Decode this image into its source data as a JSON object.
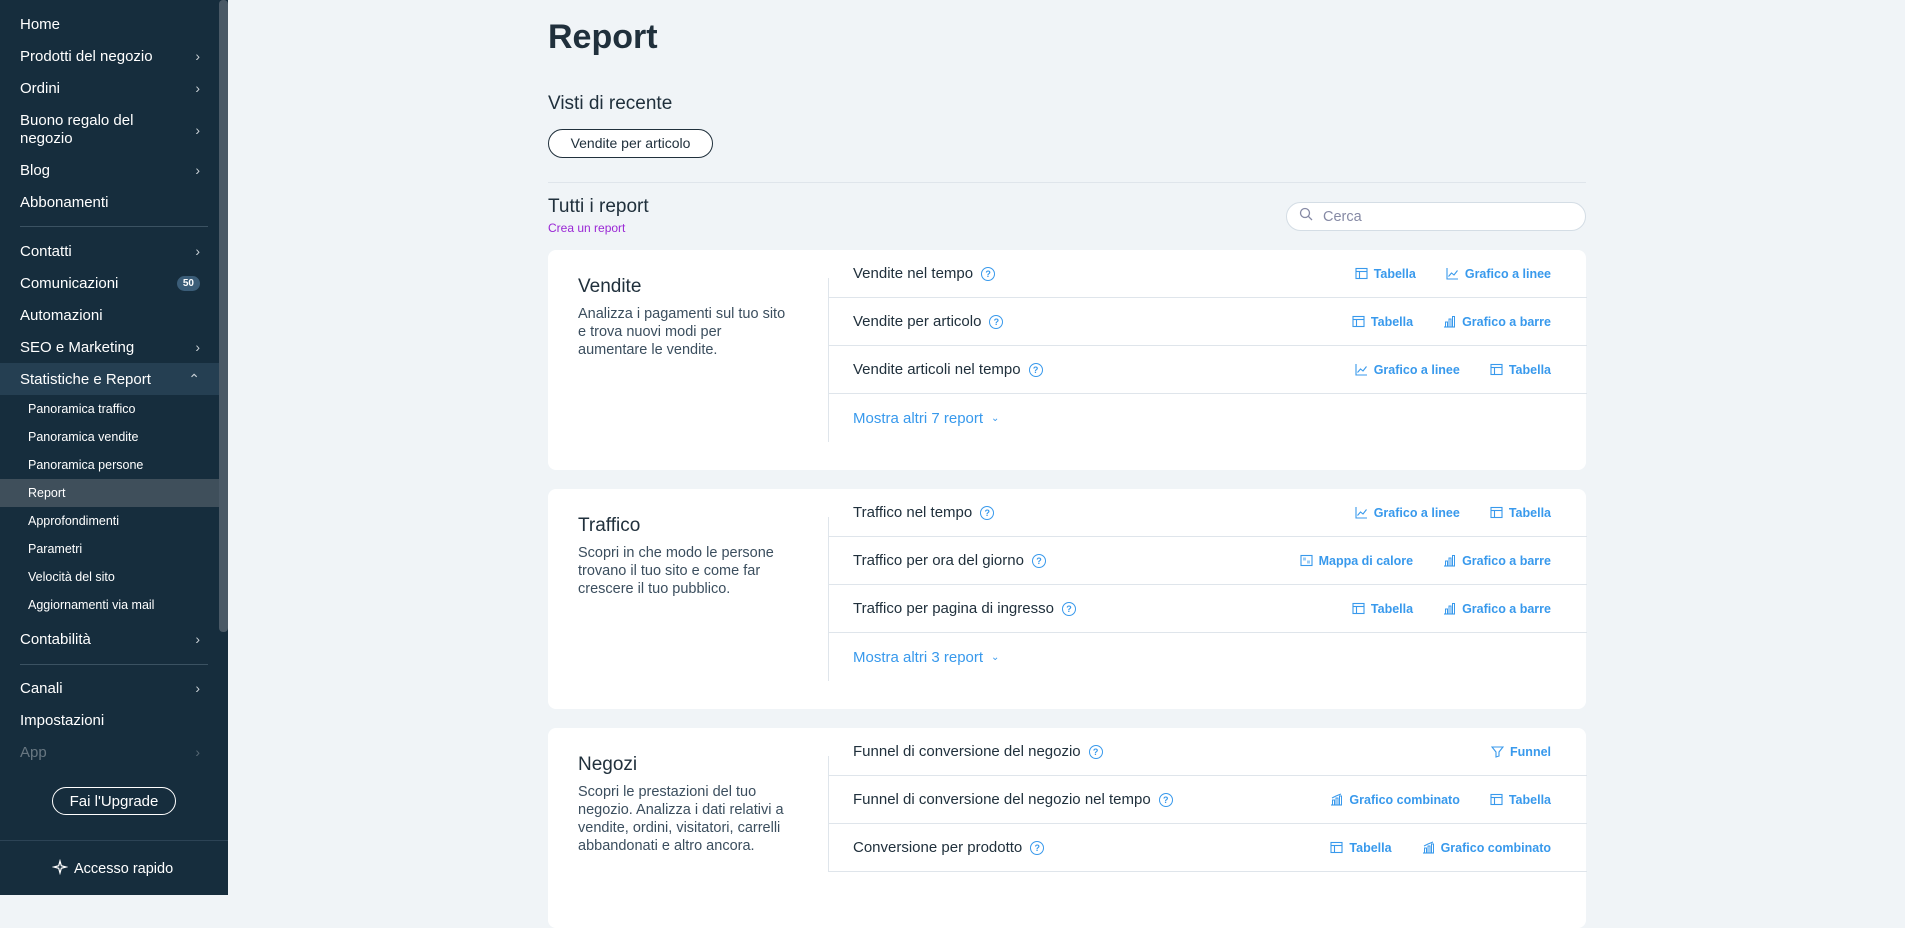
{
  "sidebar": {
    "items": [
      {
        "label": "Home",
        "chevron": false
      },
      {
        "label": "Prodotti del negozio",
        "chevron": true
      },
      {
        "label": "Ordini",
        "chevron": true
      },
      {
        "label": "Buono regalo del negozio",
        "chevron": true
      },
      {
        "label": "Blog",
        "chevron": true
      },
      {
        "label": "Abbonamenti",
        "chevron": false
      },
      {
        "label": "Contatti",
        "chevron": true
      },
      {
        "label": "Comunicazioni",
        "chevron": false,
        "badge": "50"
      },
      {
        "label": "Automazioni",
        "chevron": false
      },
      {
        "label": "SEO e Marketing",
        "chevron": true
      },
      {
        "label": "Statistiche e Report",
        "chevron": true,
        "expanded": true
      },
      {
        "label": "Contabilità",
        "chevron": true
      },
      {
        "label": "Canali",
        "chevron": true
      },
      {
        "label": "Impostazioni",
        "chevron": false
      },
      {
        "label": "App",
        "chevron": true
      }
    ],
    "subitems": [
      {
        "label": "Panoramica traffico"
      },
      {
        "label": "Panoramica vendite"
      },
      {
        "label": "Panoramica persone"
      },
      {
        "label": "Report",
        "active": true
      },
      {
        "label": "Approfondimenti"
      },
      {
        "label": "Parametri"
      },
      {
        "label": "Velocità del sito"
      },
      {
        "label": "Aggiornamenti via mail"
      }
    ],
    "upgrade_label": "Fai l'Upgrade",
    "quick_access_label": "Accesso rapido"
  },
  "main": {
    "title": "Report",
    "recent_title": "Visti di recente",
    "recent_chip": "Vendite per articolo",
    "all_title": "Tutti i report",
    "create_link": "Crea un report",
    "search_placeholder": "Cerca",
    "cards": [
      {
        "title": "Vendite",
        "description": "Analizza i pagamenti sul tuo sito e trova nuovi modi per aumentare le vendite.",
        "rows": [
          {
            "label": "Vendite nel tempo",
            "links": [
              {
                "icon": "table-icon",
                "label": "Tabella"
              },
              {
                "icon": "line-chart-icon",
                "label": "Grafico a linee"
              }
            ]
          },
          {
            "label": "Vendite per articolo",
            "links": [
              {
                "icon": "table-icon",
                "label": "Tabella"
              },
              {
                "icon": "bar-chart-icon",
                "label": "Grafico a barre"
              }
            ]
          },
          {
            "label": "Vendite articoli nel tempo",
            "links": [
              {
                "icon": "line-chart-icon",
                "label": "Grafico a linee"
              },
              {
                "icon": "table-icon",
                "label": "Tabella"
              }
            ]
          }
        ],
        "more": "Mostra altri 7 report"
      },
      {
        "title": "Traffico",
        "description": "Scopri in che modo le persone trovano il tuo sito e come far crescere il tuo pubblico.",
        "rows": [
          {
            "label": "Traffico nel tempo",
            "links": [
              {
                "icon": "line-chart-icon",
                "label": "Grafico a linee"
              },
              {
                "icon": "table-icon",
                "label": "Tabella"
              }
            ]
          },
          {
            "label": "Traffico per ora del giorno",
            "links": [
              {
                "icon": "heatmap-icon",
                "label": "Mappa di calore"
              },
              {
                "icon": "bar-chart-icon",
                "label": "Grafico a barre"
              }
            ]
          },
          {
            "label": "Traffico per pagina di ingresso",
            "links": [
              {
                "icon": "table-icon",
                "label": "Tabella"
              },
              {
                "icon": "bar-chart-icon",
                "label": "Grafico a barre"
              }
            ]
          }
        ],
        "more": "Mostra altri 3 report"
      },
      {
        "title": "Negozi",
        "description": "Scopri le prestazioni del tuo negozio. Analizza i dati relativi a vendite, ordini, visitatori, carrelli abbandonati e altro ancora.",
        "rows": [
          {
            "label": "Funnel di conversione del negozio",
            "links": [
              {
                "icon": "funnel-icon",
                "label": "Funnel"
              }
            ]
          },
          {
            "label": "Funnel di conversione del negozio nel tempo",
            "links": [
              {
                "icon": "combo-chart-icon",
                "label": "Grafico combinato"
              },
              {
                "icon": "table-icon",
                "label": "Tabella"
              }
            ]
          },
          {
            "label": "Conversione per prodotto",
            "links": [
              {
                "icon": "table-icon",
                "label": "Tabella"
              },
              {
                "icon": "combo-chart-icon",
                "label": "Grafico combinato"
              }
            ]
          }
        ],
        "more": ""
      }
    ]
  }
}
